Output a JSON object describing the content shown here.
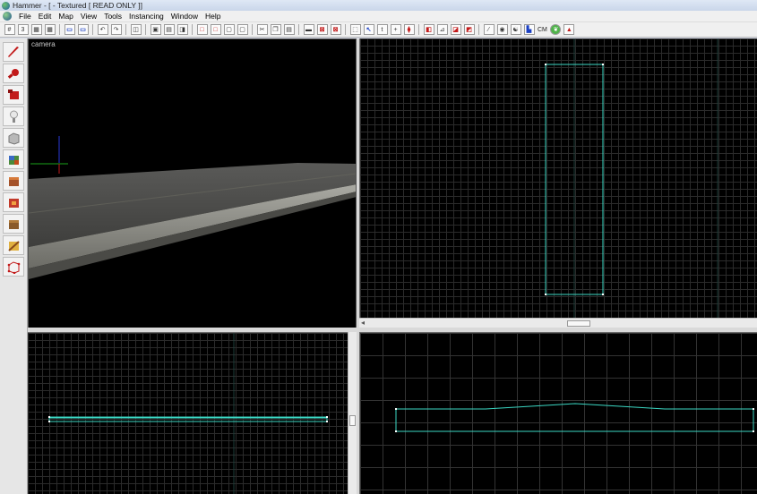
{
  "window": {
    "app_title": "Hammer - [ - Textured [ READ ONLY ]]"
  },
  "menu": {
    "items": [
      "File",
      "Edit",
      "Map",
      "View",
      "Tools",
      "Instancing",
      "Window",
      "Help"
    ]
  },
  "toolbar": {
    "cm_label": "CM"
  },
  "tool_palette": {
    "tools": [
      "selection-tool",
      "magnify-tool",
      "camera-tool",
      "entity-tool",
      "block-tool",
      "texture-application-tool",
      "apply-current-texture-tool",
      "decal-tool",
      "overlay-tool",
      "clipping-tool",
      "vertex-tool"
    ]
  },
  "viewports": {
    "camera_label": "camera",
    "camera_mode": "Textured"
  },
  "colors": {
    "brush_outline": "#3bd8c4",
    "grid_line": "#2b2b2b",
    "viewport_bg": "#000000",
    "chrome_bg": "#f0f0f0"
  }
}
